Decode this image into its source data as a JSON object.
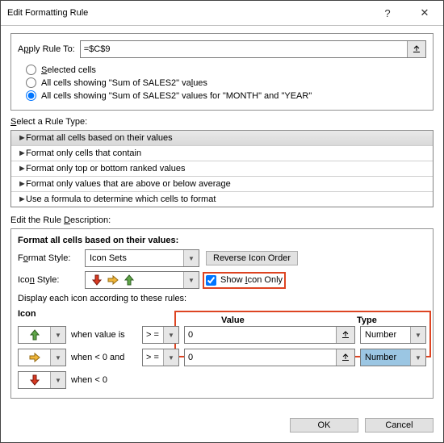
{
  "window": {
    "title": "Edit Formatting Rule",
    "help": "?",
    "close": "✕"
  },
  "apply": {
    "label_pre": "A",
    "label_u": "p",
    "label_post": "ply Rule To:",
    "formula": "=$C$9"
  },
  "scope": {
    "opt1_pre": "",
    "opt1_u": "S",
    "opt1_post": "elected cells",
    "opt2_pre": "All cells showing \"Sum of SALES2\" va",
    "opt2_u": "l",
    "opt2_post": "ues",
    "opt3": "All cells showing \"Sum of SALES2\" values for \"MONTH\" and \"YEAR\""
  },
  "ruleTypeTitle_pre": "",
  "ruleTypeTitle_u": "S",
  "ruleTypeTitle_post": "elect a Rule Type:",
  "ruleTypes": [
    "Format all cells based on their values",
    "Format only cells that contain",
    "Format only top or bottom ranked values",
    "Format only values that are above or below average",
    "Use a formula to determine which cells to format"
  ],
  "editTitle_pre": "Edit the Rule ",
  "editTitle_u": "D",
  "editTitle_post": "escription:",
  "descHeading": "Format all cells based on their values:",
  "style": {
    "label_pre": "F",
    "label_u": "o",
    "label_post": "rmat Style:",
    "value": "Icon Sets",
    "reverseBtn": "Reverse Icon Order"
  },
  "iconStyle": {
    "label_pre": "Ico",
    "label_u": "n",
    "label_post": " Style:",
    "showIcon_pre": "Show ",
    "showIcon_u": "I",
    "showIcon_post": "con Only"
  },
  "rulesCaption": "Display each icon according to these rules:",
  "grid": {
    "hIcon": "Icon",
    "hValue": "Value",
    "hType": "Type",
    "when1": "when value is",
    "when2": "when < 0 and",
    "when3": "when < 0",
    "op": "> =",
    "val": "0",
    "type": "Number"
  },
  "buttons": {
    "ok": "OK",
    "cancel": "Cancel"
  }
}
